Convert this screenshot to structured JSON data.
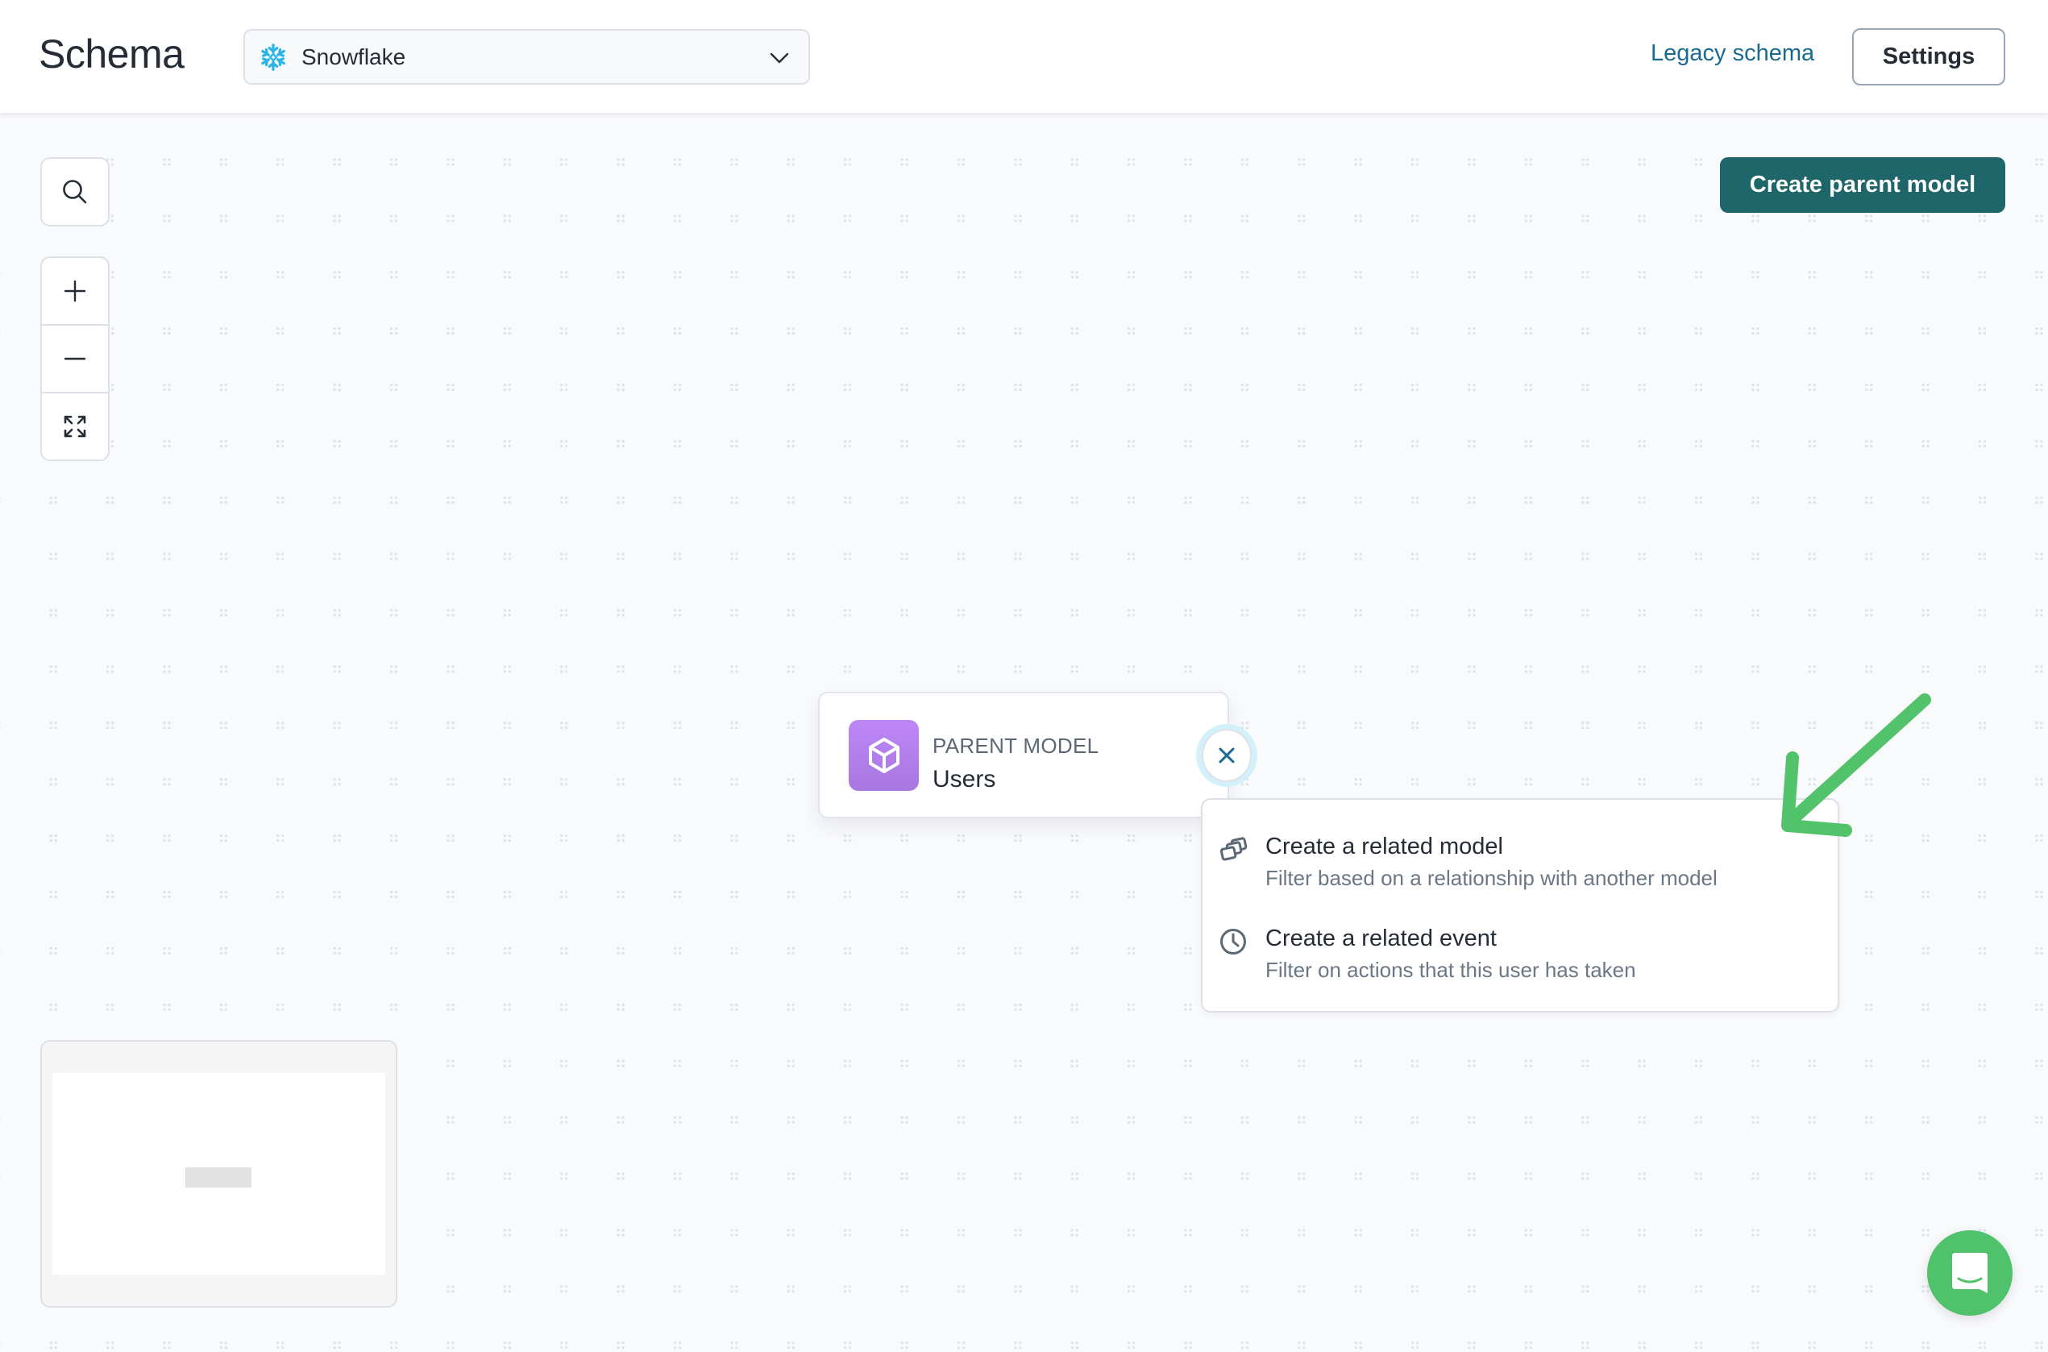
{
  "header": {
    "app_title": "Schema",
    "source_select": {
      "icon": "snowflake-icon",
      "selected": "Snowflake",
      "chevron": "chevron-down-icon"
    },
    "legacy_link": "Legacy schema",
    "settings_label": "Settings"
  },
  "toolbar": {
    "create_parent_model_label": "Create parent model"
  },
  "canvas_controls": {
    "search_icon": "search-icon",
    "zoom_in_icon": "plus-icon",
    "zoom_out_icon": "minus-icon",
    "fit_view_icon": "expand-icon"
  },
  "model_card": {
    "icon": "cube-icon",
    "kicker": "PARENT MODEL",
    "name": "Users",
    "close_icon": "close-icon"
  },
  "menu": {
    "items": [
      {
        "icon": "stacked-cards-icon",
        "title": "Create a related model",
        "description": "Filter based on a relationship with another model"
      },
      {
        "icon": "clock-icon",
        "title": "Create a related event",
        "description": "Filter on actions that this user has taken"
      }
    ]
  },
  "annotation": {
    "arrow_icon": "arrow-down-left-icon",
    "color": "#52c26b"
  },
  "colors": {
    "primary": "#1f666a",
    "link": "#1a6a91",
    "model_icon": "#b47ff0",
    "chat": "#50c26b"
  },
  "chat": {
    "icon": "chat-bubble-icon"
  }
}
